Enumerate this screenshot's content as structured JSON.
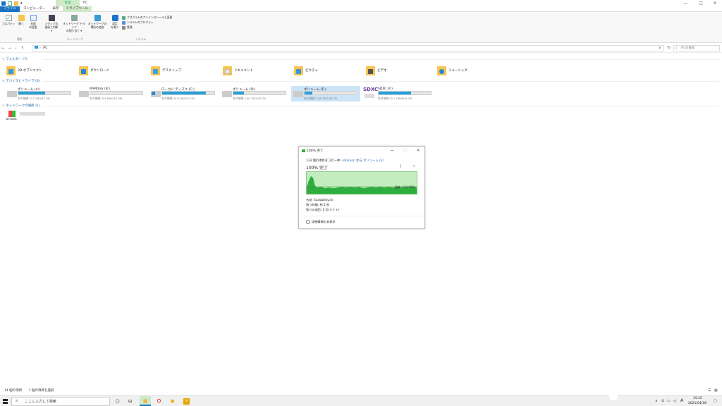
{
  "titlebar": {
    "context_tab": "管理",
    "title": "PC",
    "controls": [
      "—",
      "□",
      "✕"
    ]
  },
  "tabs": [
    "ファイル",
    "コンピューター",
    "表示",
    "ドライブツール"
  ],
  "ribbon": {
    "buttons": [
      {
        "label": "プロパティ",
        "label2": ""
      },
      {
        "label": "開く",
        "label2": ""
      },
      {
        "label": "名前",
        "label2": "の変更"
      },
      {
        "label": "メディアの",
        "label2": "接続と切断 ▾"
      },
      {
        "label": "ネットワーク ドライブ",
        "label2": "の割り当て ▾"
      },
      {
        "label": "ネットワークの",
        "label2": "場所の追加"
      },
      {
        "label": "設定",
        "label2": "を開く"
      }
    ],
    "small": [
      "プログラムのアンインストールと変更",
      "システムのプロパティ",
      "管理"
    ],
    "groups": [
      "場所",
      "ネットワーク",
      "システム"
    ]
  },
  "address": {
    "path": "PC",
    "search_placeholder": "PCの検索"
  },
  "sections": {
    "folders": "フォルダー (7)",
    "devices": "デバイスとドライブ (6)",
    "network": "ネットワークの場所 (1)"
  },
  "folders": [
    {
      "name": "3D オブジェクト",
      "color": "#3a9ad9"
    },
    {
      "name": "ダウンロード",
      "color": "#2b87d1"
    },
    {
      "name": "デスクトップ",
      "color": "#3ba3e0"
    },
    {
      "name": "ドキュメント",
      "color": "#bfbfbf"
    },
    {
      "name": "ピクチャ",
      "color": "#3c94d6"
    },
    {
      "name": "ビデオ",
      "color": "#555555"
    },
    {
      "name": "ミュージック",
      "color": "#2b87d1"
    }
  ],
  "drives": [
    {
      "name": "ボリューム (A:)",
      "free": "空き領域 217 GB/447 GB",
      "used": 0.51
    },
    {
      "name": "RAMDisk (B:)",
      "free": "空き領域 254 MB/254 MB",
      "used": 0.0
    },
    {
      "name": "ローカル ディスク (C:)",
      "free": "空き領域 34.6 GB/221 GB",
      "used": 0.84
    },
    {
      "name": "ボリューム (D:)",
      "free": "空き領域 2.90 TB/3.63 TB",
      "used": 0.2
    },
    {
      "name": "ボリューム (E:)",
      "free": "空き領域 3.08 TB/3.63 TB",
      "used": 0.15
    },
    {
      "name": "SDXC (F:)",
      "free": "空き領域 22.1 GB/58.9 GB",
      "used": 0.62
    }
  ],
  "sdxc_logo": "SDXC",
  "network_item": "Windows",
  "status": {
    "items": "14 個の項目",
    "selected": "1 個の項目を選択"
  },
  "taskbar": {
    "search_placeholder": "ここに入力して検索",
    "ime": "A",
    "time": "15:25",
    "date": "2021/04/28"
  },
  "dialog": {
    "title": "100% 完了",
    "line_prefix": "133 個の項目をコピー中: ",
    "source": "common",
    "mid": " から ",
    "dest": "ボリューム (E:)",
    "percent": "100% 完了",
    "speed": "速度: 113 MB/s",
    "name": "名前: Scalability.ini",
    "remaining_time": "残り時間: 約 5 秒",
    "remaining_items": "残りの項目: 0 (0 バイト)",
    "details": "詳細情報の非表示"
  }
}
